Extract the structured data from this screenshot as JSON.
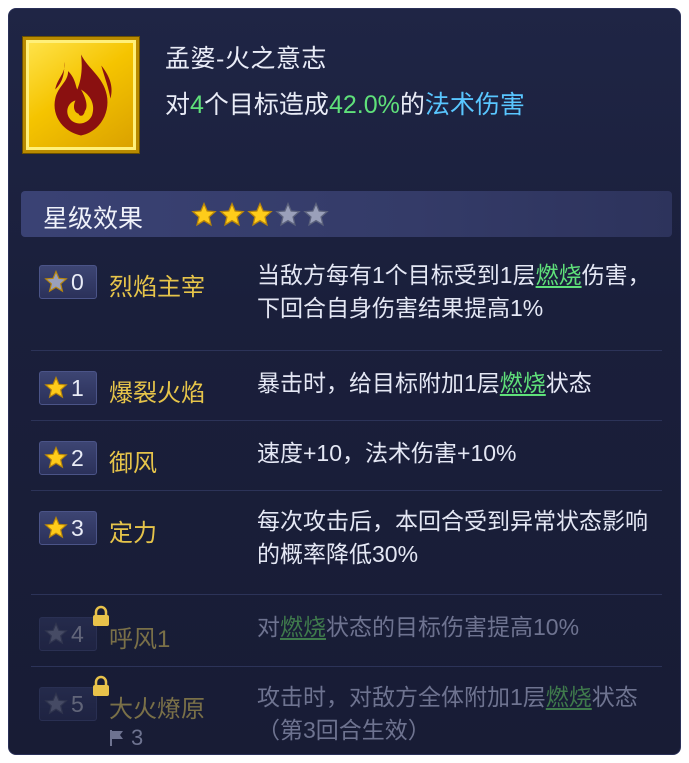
{
  "skill": {
    "name": "孟婆-火之意志",
    "desc_prefix": "对",
    "targets": "4",
    "desc_mid": "个目标造成",
    "percent": "42.0%",
    "desc_mid2": "的",
    "damage_type": "法术伤害",
    "icon": "fire-icon"
  },
  "star_effects": {
    "title": "星级效果",
    "rating": 3,
    "max_rating": 5
  },
  "rows": [
    {
      "level": "0",
      "name": "烈焰主宰",
      "text_a": "当敌方每有1个目标受到1层",
      "burn": "燃烧",
      "text_b": "伤害，下回合自身伤害结果提高1%",
      "locked": false
    },
    {
      "level": "1",
      "name": "爆裂火焰",
      "text_a": "暴击时，给目标附加1层",
      "burn": "燃烧",
      "text_b": "状态",
      "locked": false
    },
    {
      "level": "2",
      "name": "御风",
      "text_a": "速度+10，法术伤害+10%",
      "burn": "",
      "text_b": "",
      "locked": false
    },
    {
      "level": "3",
      "name": "定力",
      "text_a": "每次攻击后，本回合受到异常状态影响的概率降低30%",
      "burn": "",
      "text_b": "",
      "locked": false
    },
    {
      "level": "4",
      "name": "呼风1",
      "text_a": "对",
      "burn": "燃烧",
      "text_b": "状态的目标伤害提高10%",
      "locked": true
    },
    {
      "level": "5",
      "name": "大火燎原",
      "text_a": "攻击时，对敌方全体附加1层",
      "burn": "燃烧",
      "text_b": "状态（第3回合生效）",
      "locked": true,
      "flag_count": "3"
    }
  ],
  "colors": {
    "panel_bg": "#1c2140",
    "name_gold": "#e6c44a",
    "highlight_green": "#5fe07a",
    "highlight_cyan": "#59c6ff"
  }
}
